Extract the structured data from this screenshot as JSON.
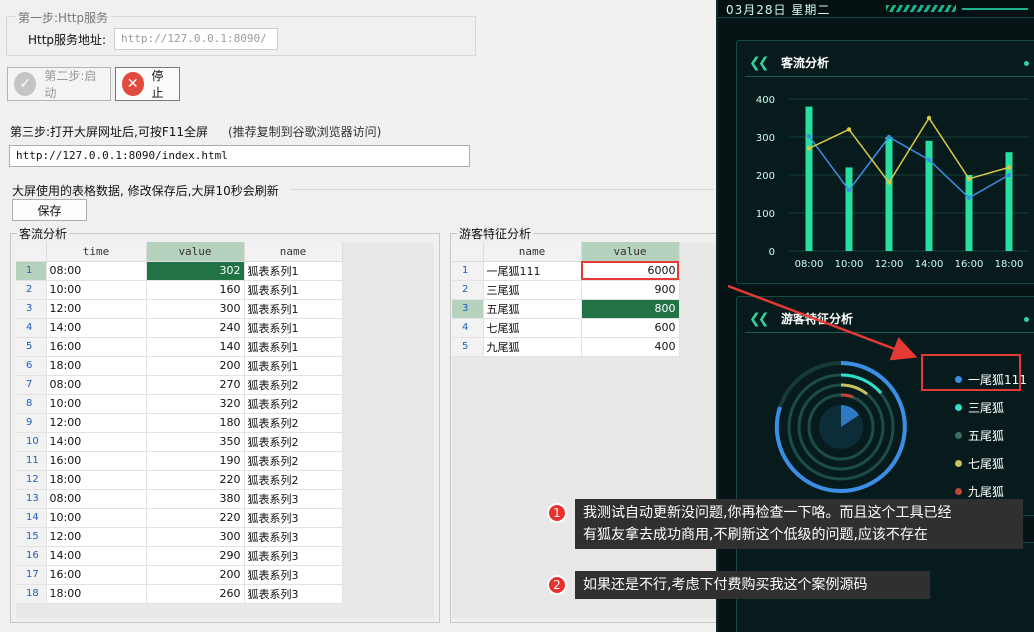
{
  "step1": {
    "title": "第一步:Http服务",
    "label": "Http服务地址:",
    "url": "http://127.0.0.1:8090/"
  },
  "step2": {
    "start_label": "第二步:启动",
    "stop_label": "停止"
  },
  "step3": {
    "label": "第三步:打开大屏网址后,可按F11全屏",
    "hint": "(推荐复制到谷歌浏览器访问)",
    "url": "http://127.0.0.1:8090/index.html"
  },
  "data_section": {
    "title": "大屏使用的表格数据, 修改保存后,大屏10秒会刷新",
    "save_label": "保存"
  },
  "traffic_table": {
    "title": "客流分析",
    "columns": [
      "time",
      "value",
      "name"
    ],
    "rows": [
      [
        "08:00",
        "302",
        "狐表系列1"
      ],
      [
        "10:00",
        "160",
        "狐表系列1"
      ],
      [
        "12:00",
        "300",
        "狐表系列1"
      ],
      [
        "14:00",
        "240",
        "狐表系列1"
      ],
      [
        "16:00",
        "140",
        "狐表系列1"
      ],
      [
        "18:00",
        "200",
        "狐表系列1"
      ],
      [
        "08:00",
        "270",
        "狐表系列2"
      ],
      [
        "10:00",
        "320",
        "狐表系列2"
      ],
      [
        "12:00",
        "180",
        "狐表系列2"
      ],
      [
        "14:00",
        "350",
        "狐表系列2"
      ],
      [
        "16:00",
        "190",
        "狐表系列2"
      ],
      [
        "18:00",
        "220",
        "狐表系列2"
      ],
      [
        "08:00",
        "380",
        "狐表系列3"
      ],
      [
        "10:00",
        "220",
        "狐表系列3"
      ],
      [
        "12:00",
        "300",
        "狐表系列3"
      ],
      [
        "14:00",
        "290",
        "狐表系列3"
      ],
      [
        "16:00",
        "200",
        "狐表系列3"
      ],
      [
        "18:00",
        "260",
        "狐表系列3"
      ]
    ]
  },
  "visitor_table": {
    "title": "游客特征分析",
    "columns": [
      "name",
      "value"
    ],
    "rows": [
      [
        "一尾狐111",
        "6000"
      ],
      [
        "三尾狐",
        "900"
      ],
      [
        "五尾狐",
        "800"
      ],
      [
        "七尾狐",
        "600"
      ],
      [
        "九尾狐",
        "400"
      ]
    ]
  },
  "dashboard": {
    "datetime": "03月28日  星期二",
    "traffic_title": "客流分析",
    "visitor_title": "游客特征分析",
    "legend": [
      {
        "name": "一尾狐111",
        "color": "#3a8ee6"
      },
      {
        "name": "三尾狐",
        "color": "#2fe0c8"
      },
      {
        "name": "五尾狐",
        "color": "#3b6f5f"
      },
      {
        "name": "七尾狐",
        "color": "#c8c25a"
      },
      {
        "name": "九尾狐",
        "color": "#c0463a"
      }
    ]
  },
  "chart_data": {
    "type": "bar",
    "categories": [
      "08:00",
      "10:00",
      "12:00",
      "14:00",
      "16:00",
      "18:00"
    ],
    "series": [
      {
        "name": "狐表系列1",
        "type": "line",
        "values": [
          302,
          160,
          300,
          240,
          140,
          200
        ],
        "color": "#3a8ee6"
      },
      {
        "name": "狐表系列2",
        "type": "line",
        "values": [
          270,
          320,
          180,
          350,
          190,
          220
        ],
        "color": "#d9c94a"
      },
      {
        "name": "狐表系列3",
        "type": "bar",
        "values": [
          380,
          220,
          300,
          290,
          200,
          260
        ],
        "color": "#27e0a0"
      }
    ],
    "ylim": [
      0,
      400
    ],
    "yticks": [
      "0",
      "100",
      "200",
      "300",
      "400"
    ]
  },
  "annotations": [
    {
      "num": "1",
      "text_line1": "我测试自动更新没问题,你再检查一下咯。而且这个工具已经",
      "text_line2": "有狐友拿去成功商用,不刷新这个低级的问题,应该不存在"
    },
    {
      "num": "2",
      "text_line1": "如果还是不行,考虑下付费购买我这个案例源码"
    }
  ]
}
